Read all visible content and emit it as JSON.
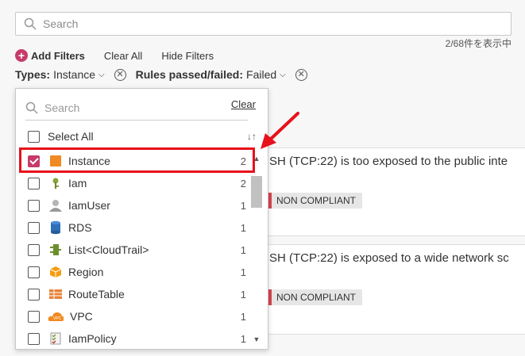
{
  "search": {
    "placeholder": "Search"
  },
  "results_count": "2/68件を表示中",
  "filter_actions": {
    "add_filters": "Add Filters",
    "clear_all": "Clear All",
    "hide_filters": "Hide Filters"
  },
  "chips": [
    {
      "label": "Types:",
      "value": "Instance"
    },
    {
      "label": "Rules passed/failed:",
      "value": "Failed"
    }
  ],
  "cards": [
    {
      "title": "SH (TCP:22) is too exposed to the public inte",
      "status": "NON COMPLIANT"
    },
    {
      "title": "SH (TCP:22) is exposed to a wide network sc",
      "status": "NON COMPLIANT"
    }
  ],
  "dropdown": {
    "search_placeholder": "Search",
    "clear": "Clear",
    "select_all": "Select All",
    "items": [
      {
        "label": "Instance",
        "count": "2",
        "checked": true,
        "icon": "instance-icon"
      },
      {
        "label": "Iam",
        "count": "2",
        "checked": false,
        "icon": "key-icon"
      },
      {
        "label": "IamUser",
        "count": "1",
        "checked": false,
        "icon": "user-icon"
      },
      {
        "label": "RDS",
        "count": "1",
        "checked": false,
        "icon": "database-icon"
      },
      {
        "label": "List<CloudTrail>",
        "count": "1",
        "checked": false,
        "icon": "cloudtrail-icon"
      },
      {
        "label": "Region",
        "count": "1",
        "checked": false,
        "icon": "region-icon"
      },
      {
        "label": "RouteTable",
        "count": "1",
        "checked": false,
        "icon": "route-table-icon"
      },
      {
        "label": "VPC",
        "count": "1",
        "checked": false,
        "icon": "vpc-icon"
      },
      {
        "label": "IamPolicy",
        "count": "1",
        "checked": false,
        "icon": "policy-icon"
      }
    ]
  },
  "colors": {
    "accent": "#c73a6a",
    "highlight": "#e8111b",
    "non_compliant": "#d64550"
  }
}
